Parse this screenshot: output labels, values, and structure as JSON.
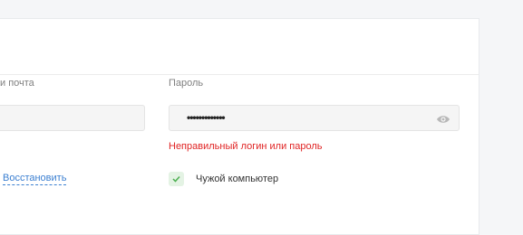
{
  "login": {
    "label": "и почта"
  },
  "password": {
    "label": "Пароль",
    "value": "•••••••••••••",
    "error": "Неправильный логин или пароль"
  },
  "links": {
    "restore": "Восстановить"
  },
  "remember": {
    "label": "Чужой компьютер",
    "checked": true
  },
  "colors": {
    "error": "#e02424",
    "link": "#3b7fd1",
    "checkbox_bg": "#e4f3e4",
    "check_mark": "#4caf50"
  },
  "icons": {
    "password_toggle": "eye-icon",
    "checkbox": "check-icon"
  }
}
